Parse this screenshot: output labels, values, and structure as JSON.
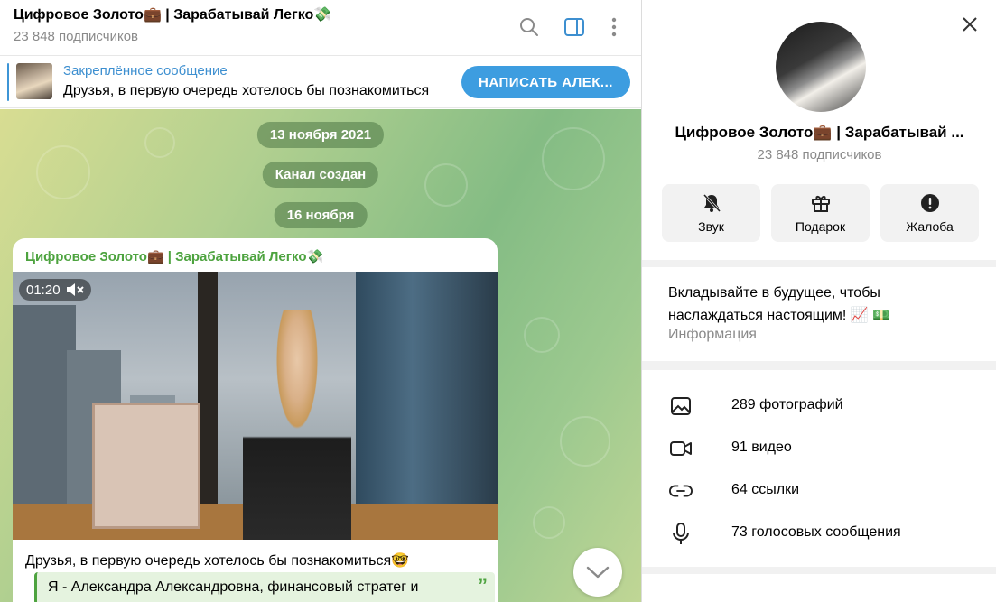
{
  "chat": {
    "title": "Цифровое Золото💼 | Зарабатывай Легко💸",
    "subscribers": "23 848 подписчиков"
  },
  "pinned": {
    "label": "Закреплённое сообщение",
    "text": "Друзья, в первую очередь хотелось бы познакомиться",
    "action": "НАПИСАТЬ АЛЕК..."
  },
  "service": {
    "date1": "13 ноября 2021",
    "created": "Канал создан",
    "date2": "16 ноября"
  },
  "post": {
    "author": "Цифровое Золото💼 | Зарабатывай Легко💸",
    "video_duration": "01:20",
    "caption": "Друзья, в первую очередь хотелось бы познакомиться🤓",
    "quote": "Я -  Александра Александровна, финансовый стратег и",
    "quote_mark": "”"
  },
  "panel": {
    "title": "Цифровое Золото💼 | Зарабатывай ...",
    "subscribers": "23 848 подписчиков",
    "actions": [
      {
        "label": "Звук",
        "icon": "muted-bell-icon"
      },
      {
        "label": "Подарок",
        "icon": "gift-icon"
      },
      {
        "label": "Жалоба",
        "icon": "warning-icon"
      }
    ],
    "description": "Вкладывайте в будущее, чтобы наслаждаться настоящим! 📈 💵",
    "description_label": "Информация",
    "media": [
      {
        "label": "289 фотографий",
        "icon": "photo-icon"
      },
      {
        "label": "91 видео",
        "icon": "video-icon"
      },
      {
        "label": "64 ссылки",
        "icon": "link-icon"
      },
      {
        "label": "73 голосовых сообщения",
        "icon": "microphone-icon"
      }
    ]
  },
  "colors": {
    "accent": "#3d9de0",
    "author_green": "#4da33f",
    "muted_text": "#8a8a8a"
  }
}
